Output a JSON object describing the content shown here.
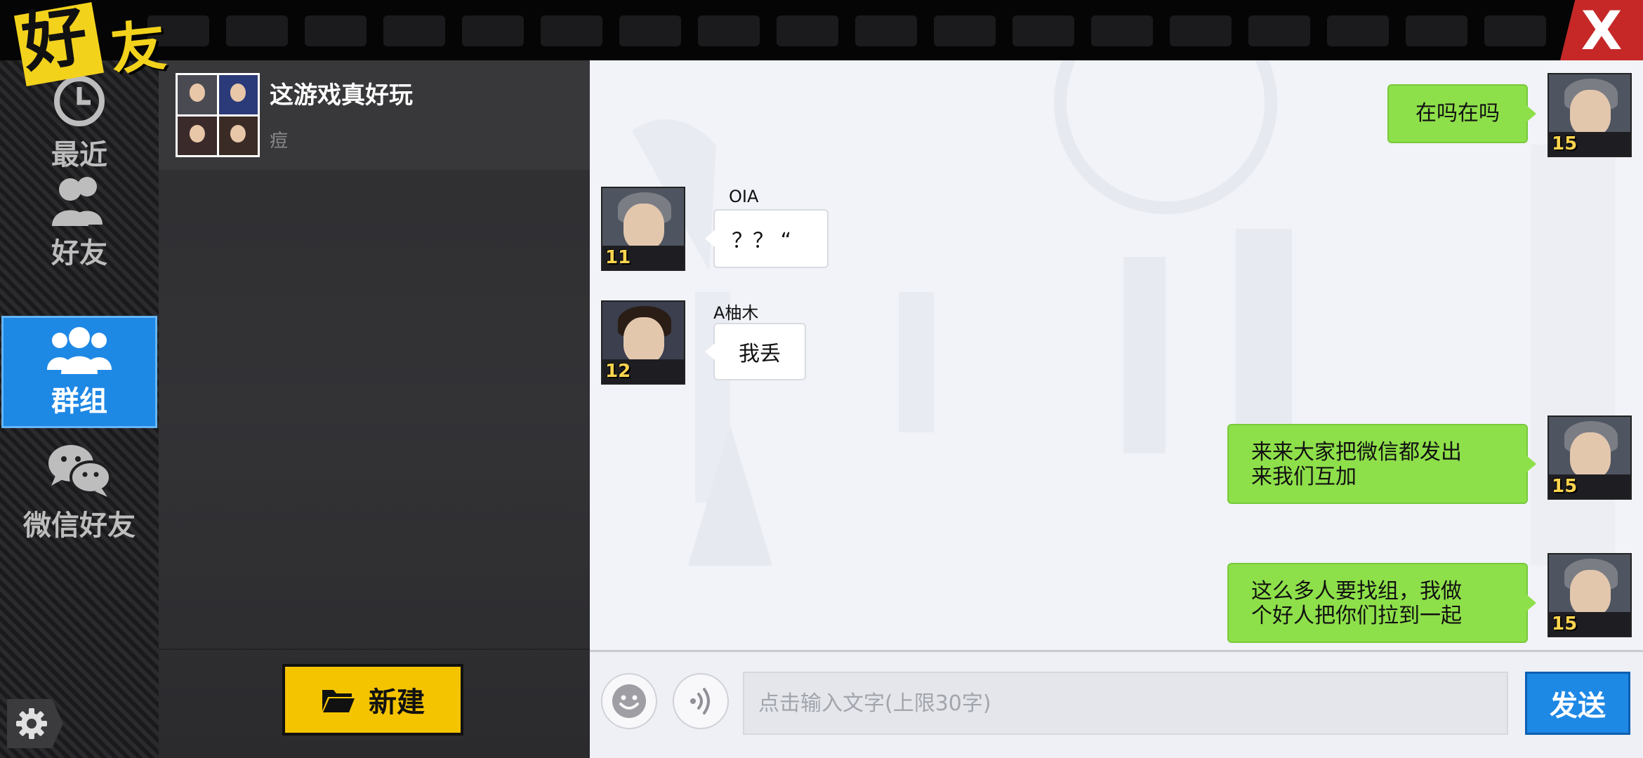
{
  "window": {
    "title": "好友",
    "title_part1": "好",
    "title_part2": "友",
    "close_glyph": "X"
  },
  "nav": {
    "items": [
      {
        "label": "最近",
        "icon": "clock-icon"
      },
      {
        "label": "好友",
        "icon": "friends-icon"
      },
      {
        "label": "群组",
        "icon": "group-icon",
        "active": true
      },
      {
        "label": "微信好友",
        "icon": "wechat-icon"
      }
    ],
    "settings_icon": "gear-icon"
  },
  "group_list": {
    "items": [
      {
        "name": "这游戏真好玩",
        "last_message": "痘"
      }
    ],
    "new_button": "新建"
  },
  "chat": {
    "messages": [
      {
        "from": "me",
        "text": "在吗在吗",
        "level": "15"
      },
      {
        "from": "other",
        "sender": "OIA",
        "text": "？？ “",
        "level": "11"
      },
      {
        "from": "other",
        "sender": "A柚木",
        "text": "我丢",
        "level": "12"
      },
      {
        "from": "me",
        "line1": "来来大家把微信都发出",
        "line2": "来我们互加",
        "level": "15"
      },
      {
        "from": "me",
        "line1": "这么多人要找组，我做",
        "line2": "个好人把你们拉到一起",
        "level": "15"
      }
    ]
  },
  "input": {
    "placeholder": "点击输入文字(上限30字)",
    "send_label": "发送",
    "emoji_icon": "smiley-icon",
    "voice_icon": "voice-icon"
  },
  "colors": {
    "accent_blue": "#1e88e5",
    "bubble_green": "#8ee04a",
    "new_button_yellow": "#f5c400",
    "close_red": "#c62828",
    "level_yellow": "#ffd54f"
  }
}
